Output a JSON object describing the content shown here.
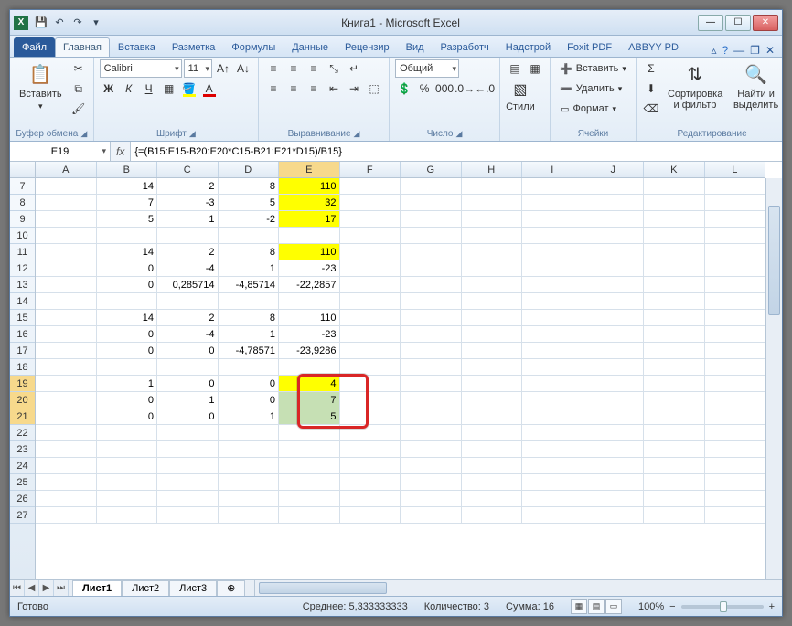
{
  "window": {
    "title": "Книга1 - Microsoft Excel"
  },
  "tabs": {
    "file": "Файл",
    "items": [
      "Главная",
      "Вставка",
      "Разметка",
      "Формулы",
      "Данные",
      "Рецензир",
      "Вид",
      "Разработч",
      "Надстрой",
      "Foxit PDF",
      "ABBYY PD"
    ],
    "active_index": 0
  },
  "ribbon": {
    "clipboard": {
      "paste": "Вставить",
      "label": "Буфер обмена"
    },
    "font": {
      "name": "Calibri",
      "size": "11",
      "label": "Шрифт"
    },
    "alignment": {
      "label": "Выравнивание"
    },
    "number": {
      "format": "Общий",
      "label": "Число"
    },
    "styles": {
      "btn": "Стили"
    },
    "cells": {
      "insert": "Вставить",
      "delete": "Удалить",
      "format": "Формат",
      "label": "Ячейки"
    },
    "editing": {
      "sort": "Сортировка и фильтр",
      "find": "Найти и выделить",
      "label": "Редактирование"
    }
  },
  "namebox": "E19",
  "formula": "{=(B15:E15-B20:E20*C15-B21:E21*D15)/B15}",
  "columns": [
    "A",
    "B",
    "C",
    "D",
    "E",
    "F",
    "G",
    "H",
    "I",
    "J",
    "K",
    "L"
  ],
  "selected_col": "E",
  "rows_start": 7,
  "rows_count": 21,
  "selected_rows": [
    19,
    20,
    21
  ],
  "cells": {
    "7": {
      "B": "14",
      "C": "2",
      "D": "8",
      "E": "110",
      "E_class": "yellow"
    },
    "8": {
      "B": "7",
      "C": "-3",
      "D": "5",
      "E": "32",
      "E_class": "yellow"
    },
    "9": {
      "B": "5",
      "C": "1",
      "D": "-2",
      "E": "17",
      "E_class": "yellow"
    },
    "11": {
      "B": "14",
      "C": "2",
      "D": "8",
      "E": "110",
      "E_class": "yellow"
    },
    "12": {
      "B": "0",
      "C": "-4",
      "D": "1",
      "E": "-23"
    },
    "13": {
      "B": "0",
      "C": "0,285714",
      "D": "-4,85714",
      "E": "-22,2857"
    },
    "15": {
      "B": "14",
      "C": "2",
      "D": "8",
      "E": "110"
    },
    "16": {
      "B": "0",
      "C": "-4",
      "D": "1",
      "E": "-23"
    },
    "17": {
      "B": "0",
      "C": "0",
      "D": "-4,78571",
      "E": "-23,9286"
    },
    "19": {
      "B": "1",
      "C": "0",
      "D": "0",
      "E": "4",
      "E_class": "active"
    },
    "20": {
      "B": "0",
      "C": "1",
      "D": "0",
      "E": "7",
      "E_class": "selrange"
    },
    "21": {
      "B": "0",
      "C": "0",
      "D": "1",
      "E": "5",
      "E_class": "selrange"
    }
  },
  "sheets": {
    "items": [
      "Лист1",
      "Лист2",
      "Лист3"
    ],
    "active_index": 0
  },
  "status": {
    "ready": "Готово",
    "avg_label": "Среднее:",
    "avg": "5,333333333",
    "count_label": "Количество:",
    "count": "3",
    "sum_label": "Сумма:",
    "sum": "16",
    "zoom": "100%"
  },
  "chart_data": null
}
